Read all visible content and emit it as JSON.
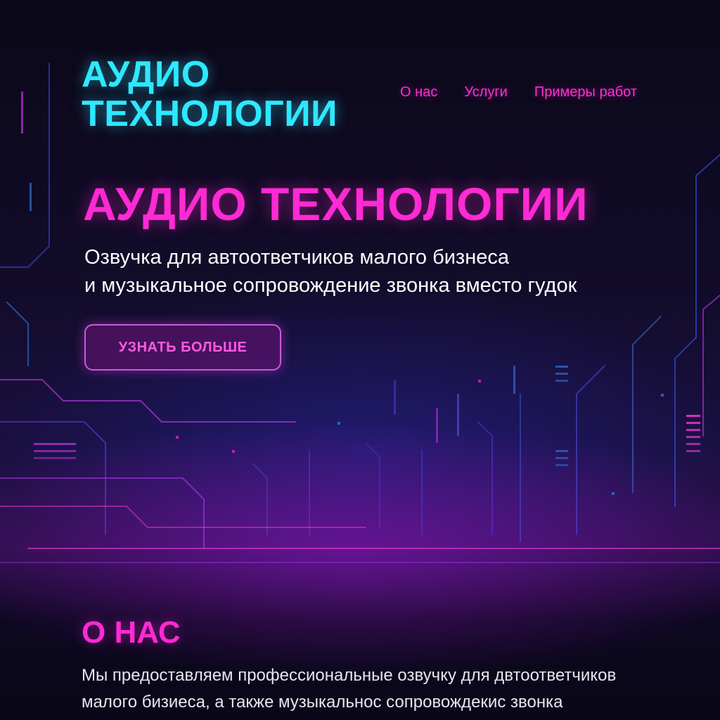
{
  "header": {
    "logo_line1": "АУДИО",
    "logo_line2": "ТЕХНОЛОГИИ",
    "nav": [
      {
        "label": "О нас"
      },
      {
        "label": "Услуги"
      },
      {
        "label": "Примеры работ"
      }
    ]
  },
  "hero": {
    "title": "АУДИО ТЕХНОЛОГИИ",
    "subtitle_line1": "Озвучка для автоответчиков малого бизнеса",
    "subtitle_line2": "и музыкальное сопровождение звонка вместо гудок",
    "cta_label": "УЗНАТЬ БОЛЬШЕ"
  },
  "about": {
    "title": "О НАС",
    "text_line1": "Мы предоставляем профессиональные озвучку для двтоответчиков",
    "text_line2": "малого бизиеса, а также музыкальнос сопровождекис звонка"
  },
  "colors": {
    "logo": "#2ee8ff",
    "accent": "#ff2ad4",
    "background": "#0a0717",
    "circuit_blue": "#3a5cff",
    "circuit_pink": "#e03cff"
  }
}
